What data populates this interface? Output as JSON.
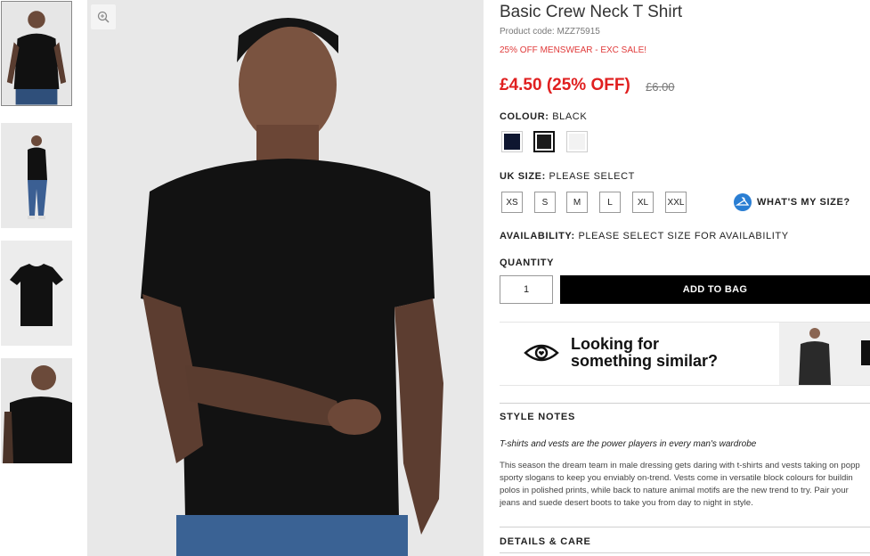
{
  "product": {
    "title": "Basic Crew Neck T Shirt",
    "code": "Product code: MZZ75915",
    "promo": "25% OFF MENSWEAR - EXC SALE!",
    "price": "£4.50 (25% OFF)",
    "was_price": "£6.00"
  },
  "colour": {
    "label": "COLOUR:",
    "value": "BLACK",
    "swatches": [
      {
        "name": "navy",
        "color": "#0e1630"
      },
      {
        "name": "black",
        "color": "#1b1b1b"
      },
      {
        "name": "white",
        "color": "#f2f2f2"
      }
    ]
  },
  "size": {
    "label": "UK SIZE:",
    "value": "PLEASE SELECT",
    "options": [
      "XS",
      "S",
      "M",
      "L",
      "XL",
      "XXL"
    ],
    "whats_my_size": "WHAT'S MY SIZE?"
  },
  "availability": {
    "label": "AVAILABILITY:",
    "value": "PLEASE SELECT SIZE FOR AVAILABILITY"
  },
  "quantity": {
    "label": "QUANTITY",
    "value": "1"
  },
  "add_to_bag": "ADD TO BAG",
  "similar": {
    "line1": "Looking for",
    "line2": "something similar?"
  },
  "style_notes": {
    "heading": "STYLE NOTES",
    "subtitle": "T-shirts and vests are the power players in every man's wardrobe",
    "body": [
      "This season the dream team in male dressing gets daring with t-shirts and vests taking on popp",
      "sporty slogans to keep you enviably on-trend. Vests come in versatile block colours for buildin",
      "polos in polished prints, while back to nature animal motifs are the new trend to try. Pair your",
      "jeans and suede desert boots to take you from day to night in style."
    ]
  },
  "details_care": {
    "heading": "DETAILS & CARE"
  },
  "icons": {
    "zoom": "zoom-in-icon",
    "hanger": "hanger-icon",
    "eye": "eye-heart-icon"
  },
  "colors": {
    "price_red": "#e02020",
    "promo_red": "#e03a3a",
    "button_black": "#000000",
    "size_help_blue": "#2a7ed3"
  }
}
